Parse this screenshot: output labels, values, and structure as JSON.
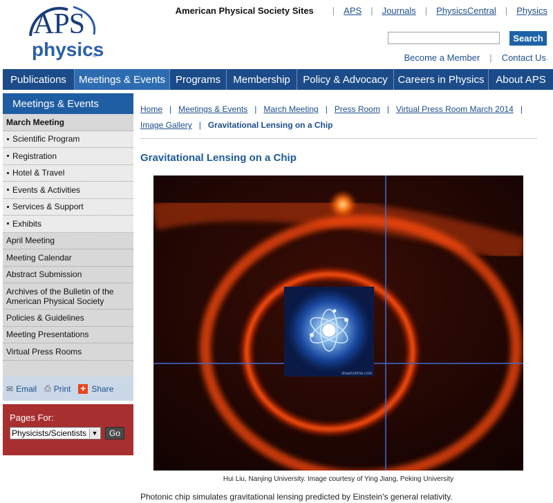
{
  "header": {
    "sites_title": "American Physical Society Sites",
    "site_links": [
      "APS",
      "Journals",
      "PhysicsCentral",
      "Physics"
    ],
    "search_placeholder": "",
    "search_button": "Search",
    "member_links": [
      "Become a Member",
      "Contact Us"
    ]
  },
  "logo": {
    "aps": "APS",
    "physics": "physics"
  },
  "nav": {
    "items": [
      "Publications",
      "Meetings & Events",
      "Programs",
      "Membership",
      "Policy & Advocacy",
      "Careers in Physics",
      "About APS"
    ],
    "active": "Meetings & Events"
  },
  "sidebar": {
    "header": "Meetings & Events",
    "current": "March Meeting",
    "sub_items": [
      "Scientific Program",
      "Registration",
      "Hotel & Travel",
      "Events & Activities",
      "Services & Support",
      "Exhibits"
    ],
    "items": [
      "April Meeting",
      "Meeting Calendar",
      "Abstract Submission",
      "Archives of the Bulletin of the American Physical Society",
      "Policies & Guidelines",
      "Meeting Presentations",
      "Virtual Press Rooms"
    ]
  },
  "share": {
    "email": "Email",
    "print": "Print",
    "share": "Share"
  },
  "pages_for": {
    "title": "Pages For:",
    "selected": "Physicists/Scientists",
    "go": "Go"
  },
  "breadcrumb": {
    "links": [
      "Home",
      "Meetings & Events",
      "March Meeting",
      "Press Room",
      "Virtual Press Room March 2014",
      "Image Gallery"
    ],
    "current": "Gravitational Lensing on a Chip"
  },
  "page_title": "Gravitational Lensing on a Chip",
  "figure": {
    "watermark": "dreamstime.com"
  },
  "caption": "Hui Liu, Nanjing University. Image courtesy of Ying Jiang, Peking University",
  "description": "Photonic chip simulates gravitational lensing predicted by Einstein's general relativity.",
  "colors": {
    "nav_bg": "#1b4b88",
    "nav_active": "#2e6cb2",
    "title_blue": "#1d5b9a",
    "pages_for_bg": "#a82f2f",
    "share_bg": "#cbd8e7"
  }
}
